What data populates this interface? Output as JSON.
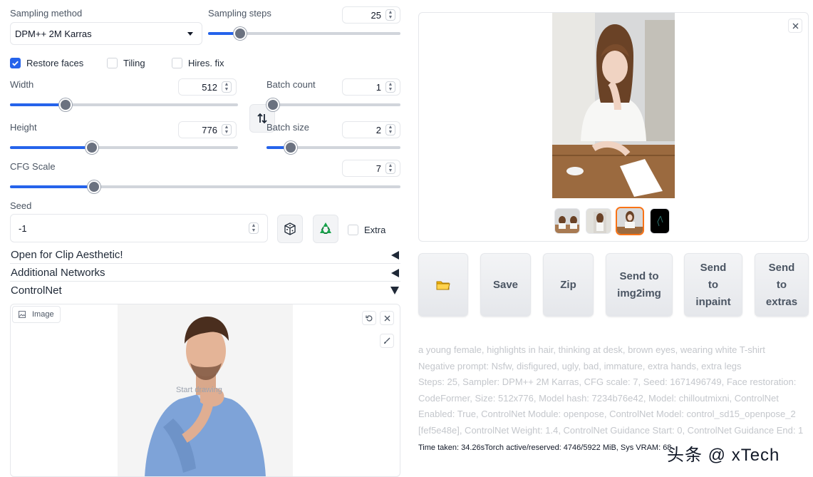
{
  "sampling": {
    "method_label": "Sampling method",
    "method_value": "DPM++ 2M Karras",
    "steps_label": "Sampling steps",
    "steps_value": "25",
    "steps_fraction": 0.165
  },
  "checkboxes": {
    "restore_faces": {
      "label": "Restore faces",
      "checked": true
    },
    "tiling": {
      "label": "Tiling",
      "checked": false
    },
    "hires_fix": {
      "label": "Hires. fix",
      "checked": false
    },
    "extra": {
      "label": "Extra",
      "checked": false
    }
  },
  "dims": {
    "width_label": "Width",
    "width_value": "512",
    "width_fraction": 0.245,
    "height_label": "Height",
    "height_value": "776",
    "height_fraction": 0.36,
    "swap_icon": "swap-vertical-arrows"
  },
  "batch": {
    "count_label": "Batch count",
    "count_value": "1",
    "count_fraction": 0.05,
    "size_label": "Batch size",
    "size_value": "2",
    "size_fraction": 0.18
  },
  "cfg": {
    "label": "CFG Scale",
    "value": "7",
    "fraction": 0.215
  },
  "seed": {
    "label": "Seed",
    "value": "-1",
    "dice_icon": "dice",
    "recycle_icon": "recycle"
  },
  "accordions": {
    "clip_aesthetic": "Open for Clip Aesthetic!",
    "additional_networks": "Additional Networks",
    "controlnet": "ControlNet"
  },
  "controlnet": {
    "image_tab_label": "Image",
    "canvas_hint": "Start drawing"
  },
  "gallery": {
    "thumb_count": 4,
    "selected_index": 2
  },
  "actions": {
    "folder_icon": "folder",
    "save": "Save",
    "zip": "Zip",
    "send_img2img_1": "Send to",
    "send_img2img_2": "img2img",
    "send_inpaint_1": "Send",
    "send_inpaint_2": "to",
    "send_inpaint_3": "inpaint",
    "send_extras_1": "Send",
    "send_extras_2": "to",
    "send_extras_3": "extras"
  },
  "generation_info": {
    "line1": "a young female, highlights in hair, thinking at desk, brown eyes, wearing white T-shirt",
    "line2": "Negative prompt: Nsfw, disfigured, ugly, bad, immature, extra hands, extra legs",
    "line3": "Steps: 25, Sampler: DPM++ 2M Karras, CFG scale: 7, Seed: 1671496749, Face restoration:",
    "line4": "CodeFormer, Size: 512x776, Model hash: 7234b76e42, Model: chilloutmixni, ControlNet",
    "line5": "Enabled: True, ControlNet Module: openpose, ControlNet Model: control_sd15_openpose_2",
    "line6": "[fef5e48e], ControlNet Weight: 1.4, ControlNet Guidance Start: 0, ControlNet Guidance End: 1"
  },
  "timer": "Time taken: 34.26sTorch active/reserved: 4746/5922 MiB, Sys VRAM: 68",
  "watermark": "头条 @ xTech",
  "colors": {
    "accent": "#2563eb",
    "selected_thumb": "#f97316"
  }
}
